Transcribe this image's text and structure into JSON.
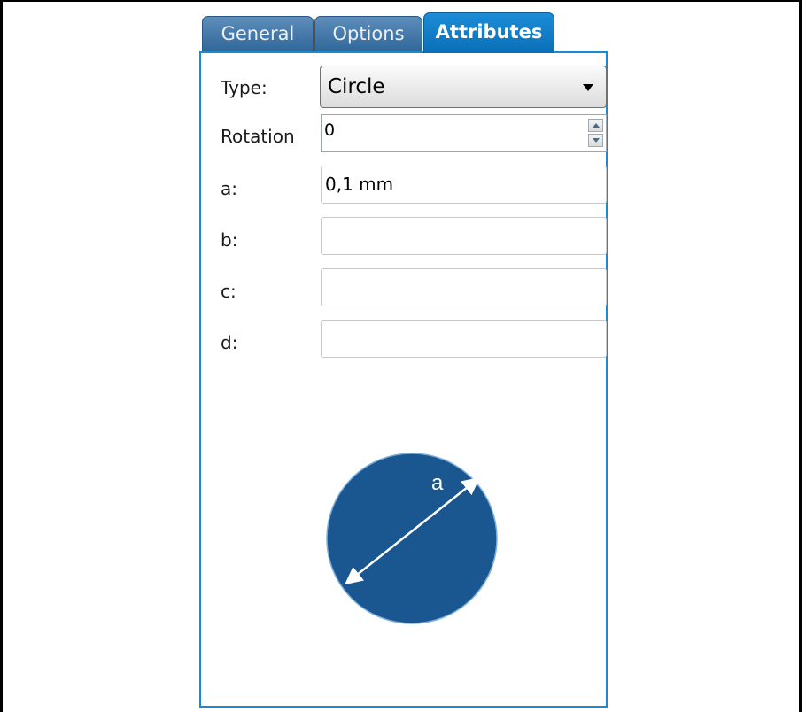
{
  "tabs": {
    "general": "General",
    "options": "Options",
    "attributes": "Attributes"
  },
  "form": {
    "type_label": "Type:",
    "type_value": "Circle",
    "rotation_label": "Rotation",
    "rotation_value": "0",
    "a_label": "a:",
    "a_value": "0,1 mm",
    "b_label": "b:",
    "b_value": "",
    "c_label": "c:",
    "c_value": "",
    "d_label": "d:",
    "d_value": ""
  },
  "diagram": {
    "dimension_label": "a",
    "circle_color": "#1a5690",
    "arrow_color": "#ffffff"
  },
  "colors": {
    "tab_active": "#0a78c4",
    "panel_border": "#1a8ad1"
  }
}
